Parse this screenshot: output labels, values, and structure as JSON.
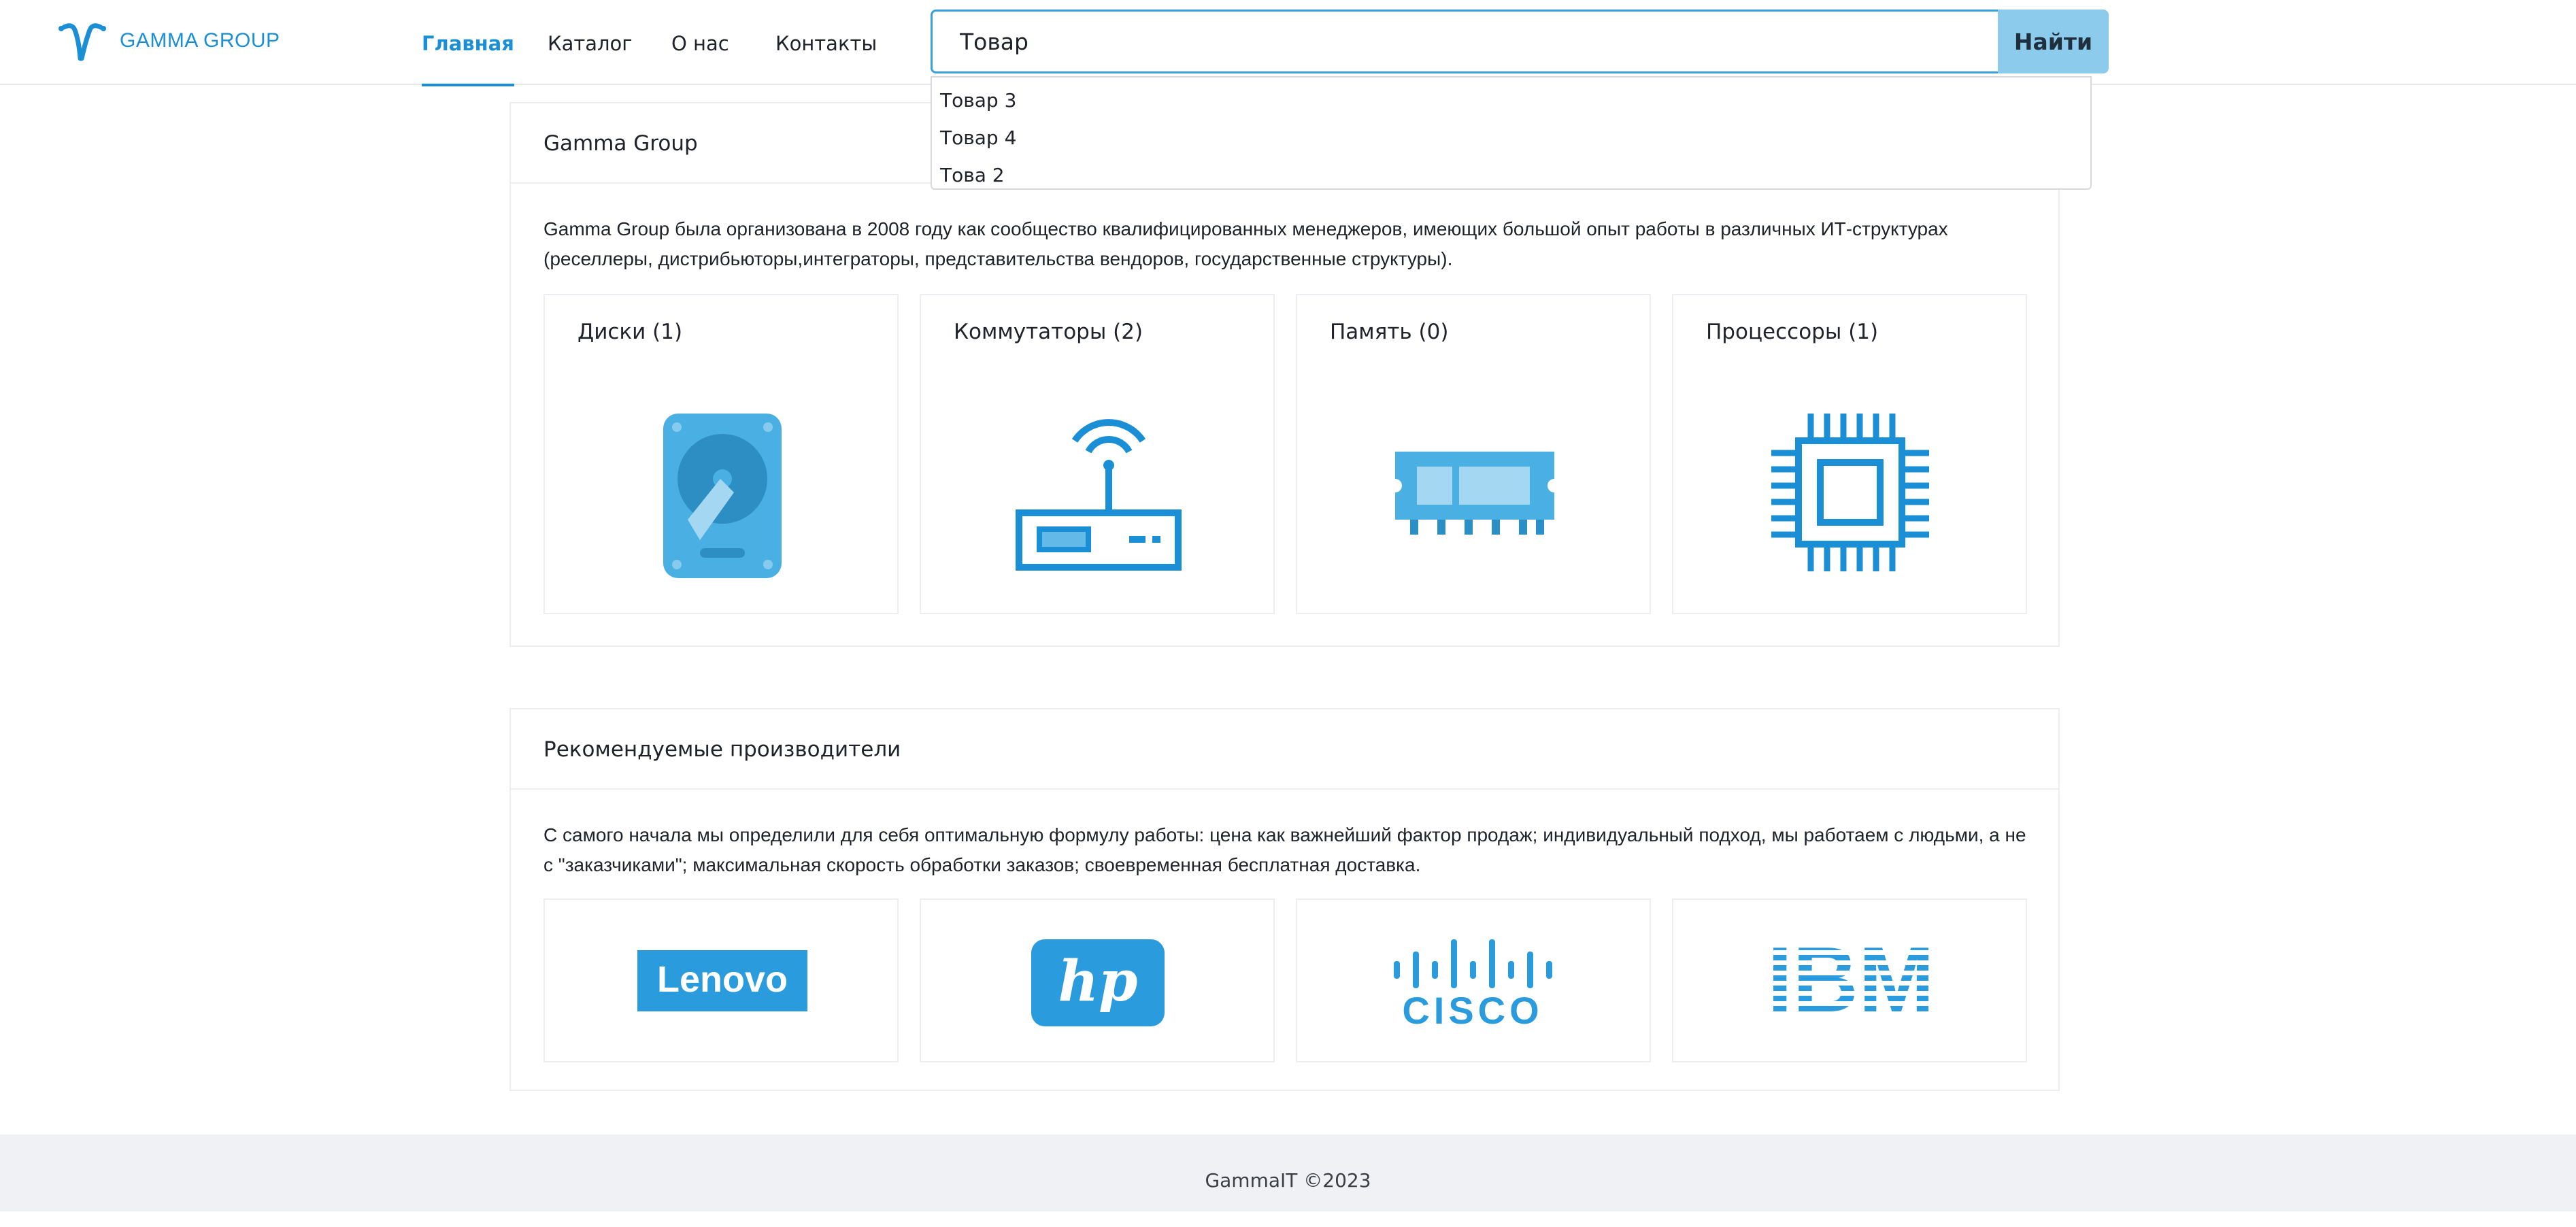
{
  "header": {
    "logo_text": "GAMMA GROUP",
    "nav": [
      "Главная",
      "Каталог",
      "О нас",
      "Контакты"
    ],
    "search": {
      "value": "Товар",
      "button_label": "Найти"
    },
    "suggestions": [
      "Товар 3",
      "Товар 4",
      "Това 2"
    ]
  },
  "about": {
    "title": "Gamma Group",
    "text": "Gamma Group была организована в 2008 году как сообщество квалифицированных менеджеров, имеющих большой опыт работы в различных ИТ-структурах (реселлеры, дистрибьюторы,интеграторы, представительства вендоров, государственные структуры).",
    "categories": [
      {
        "label": "Диски (1)",
        "icon": "hard-drive-icon"
      },
      {
        "label": "Коммутаторы (2)",
        "icon": "router-icon"
      },
      {
        "label": "Память (0)",
        "icon": "memory-module-icon"
      },
      {
        "label": "Процессоры (1)",
        "icon": "processor-icon"
      }
    ]
  },
  "vendors": {
    "title": "Рекомендуемые производители",
    "text": "С самого начала мы определили для себя оптимальную формулу работы: цена как важнейший фактор продаж; индивидуальный подход, мы работаем с людьми, а не с \"заказчиками\"; максимальная скорость обработки заказов; своевременная бесплатная доставка.",
    "logos": [
      {
        "icon": "lenovo-logo",
        "text": "Lenovo"
      },
      {
        "icon": "hp-logo",
        "text": "hp"
      },
      {
        "icon": "cisco-logo",
        "text": "CISCO"
      },
      {
        "icon": "ibm-logo",
        "text": "IBM"
      }
    ]
  },
  "footer": {
    "text": "GammaIT ©2023"
  },
  "colors": {
    "accent": "#1b8fd6",
    "icon_blue": "#2a9bdc",
    "button_bg": "#8ccbeb",
    "footer_bg": "#f0f1f4"
  }
}
